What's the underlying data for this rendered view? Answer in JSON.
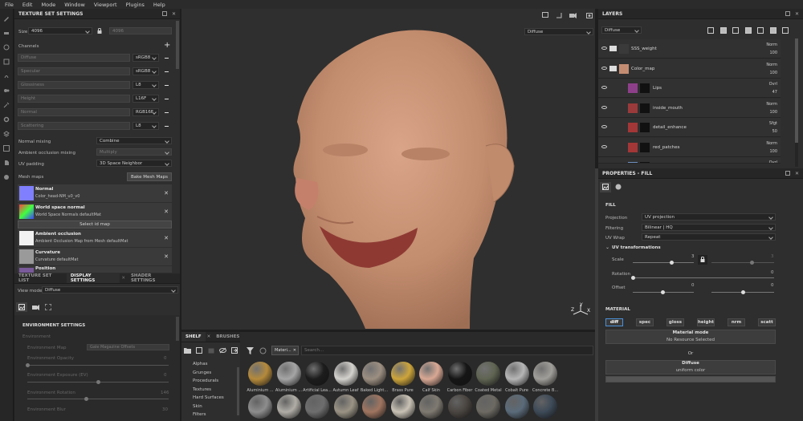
{
  "menu": [
    "File",
    "Edit",
    "Mode",
    "Window",
    "Viewport",
    "Plugins",
    "Help"
  ],
  "texture_set_settings": {
    "title": "TEXTURE SET SETTINGS",
    "size_label": "Size",
    "size_value": "4096",
    "size_linked": "4096",
    "channels_label": "Channels",
    "channels": [
      {
        "name": "Diffuse",
        "format": "sRGB8"
      },
      {
        "name": "Specular",
        "format": "sRGB8"
      },
      {
        "name": "Glossiness",
        "format": "L8"
      },
      {
        "name": "Height",
        "format": "L16F"
      },
      {
        "name": "Normal",
        "format": "RGB16F"
      },
      {
        "name": "Scattering",
        "format": "L8"
      }
    ],
    "normal_mixing_label": "Normal mixing",
    "normal_mixing_value": "Combine",
    "ao_mixing_label": "Ambient occlusion mixing",
    "ao_mixing_value": "Multiply",
    "uv_padding_label": "UV padding",
    "uv_padding_value": "3D Space Neighbor",
    "mesh_maps_label": "Mesh maps",
    "bake_button": "Bake Mesh Maps",
    "mesh_maps": [
      {
        "title": "Normal",
        "sub": "Color_head-NM_u0_v0"
      },
      {
        "title": "World space normal",
        "sub": "World Space Normals defaultMat"
      },
      {
        "title": "Ambient occlusion",
        "sub": "Ambient Occlusion Map from Mesh defaultMat"
      },
      {
        "title": "Curvature",
        "sub": "Curvature defaultMat"
      },
      {
        "title": "Position",
        "sub": ""
      }
    ],
    "select_id_map": "Select id map"
  },
  "lower_tabs": [
    "TEXTURE SET LIST",
    "DISPLAY SETTINGS",
    "SHADER SETTINGS"
  ],
  "display_settings": {
    "view_mode_label": "View mode",
    "view_mode_value": "Diffuse",
    "env_title": "ENVIRONMENT SETTINGS",
    "env_label": "Environment",
    "env_map_label": "Environment Map",
    "env_map_value": "Gale Magazine Offsets",
    "env_opacity_label": "Environment Opacity",
    "env_opacity_value": "0",
    "env_exposure_label": "Environment Exposure (EV)",
    "env_exposure_value": "0",
    "env_rotation_label": "Environment Rotation",
    "env_rotation_value": "146",
    "env_blur_label": "Environment Blur",
    "env_blur_value": "30"
  },
  "viewport": {
    "channel_select": "Diffuse",
    "gizmo": {
      "x": "X",
      "y": "Y",
      "z": "Z"
    }
  },
  "shelf": {
    "tabs": [
      "SHELF",
      "BRUSHES"
    ],
    "filter_chip": "Materi...",
    "search_placeholder": "Search...",
    "categories": [
      "Alphas",
      "Grunges",
      "Procedurals",
      "Textures",
      "Hard Surfaces",
      "Skin",
      "Filters"
    ],
    "materials": [
      {
        "name": "Aluminium ...",
        "color": "#b58a3b"
      },
      {
        "name": "Aluminium ...",
        "color": "#a5a5a5"
      },
      {
        "name": "Artificial Lea...",
        "color": "#1c1c1c"
      },
      {
        "name": "Autumn Leaf",
        "color": "#d4d2cd"
      },
      {
        "name": "Baked Light...",
        "color": "#9c8f81"
      },
      {
        "name": "Brass Pure",
        "color": "#cda53b"
      },
      {
        "name": "Calf Skin",
        "color": "#d9a894"
      },
      {
        "name": "Carbon Fiber",
        "color": "#151515"
      },
      {
        "name": "Coated Metal",
        "color": "#5f6452"
      },
      {
        "name": "Cobalt Pure",
        "color": "#b6b6b6"
      },
      {
        "name": "Concrete B...",
        "color": "#a09e99"
      }
    ],
    "materials_row2": [
      "#8d8d8d",
      "#b0ada6",
      "#6e6e6e",
      "#9a9385",
      "#a07560",
      "#c9c2b5",
      "#7f7a71",
      "#4a4540",
      "#6d6a63",
      "#5b6b7a",
      "#3d4a58"
    ]
  },
  "layers": {
    "title": "LAYERS",
    "channel": "Diffuse",
    "items": [
      {
        "name": "SSS_weight",
        "blend": "Norm",
        "opacity": "100",
        "thumb": "#3a3a3a",
        "folder": true
      },
      {
        "name": "Color_map",
        "blend": "Norm",
        "opacity": "100",
        "thumb": "#c48d72",
        "folder": true
      },
      {
        "name": "Lips",
        "blend": "Ovrl",
        "opacity": "47",
        "thumb": "#8e3f8a",
        "folder": false
      },
      {
        "name": "inside_mouth",
        "blend": "Norm",
        "opacity": "100",
        "thumb": "#9b3a3a",
        "folder": false
      },
      {
        "name": "detail_enhance",
        "blend": "Sfgt",
        "opacity": "50",
        "thumb": "#a33737",
        "folder": false
      },
      {
        "name": "red_patches",
        "blend": "Norm",
        "opacity": "100",
        "thumb": "#a33737",
        "folder": false
      },
      {
        "name": "",
        "blend": "Ovrl",
        "opacity": "",
        "thumb": "#6e8fc0",
        "folder": false
      }
    ]
  },
  "properties": {
    "title": "PROPERTIES - FILL",
    "fill_label": "FILL",
    "projection_label": "Projection",
    "projection_value": "UV projection",
    "filtering_label": "Filtering",
    "filtering_value": "Bilinear | HQ",
    "uvwrap_label": "UV Wrap",
    "uvwrap_value": "Repeat",
    "uv_transforms_label": "UV transformations",
    "scale_label": "Scale",
    "scale_value": "3",
    "scale_value2": "3",
    "rotation_label": "Rotation",
    "rotation_value": "0",
    "offset_label": "Offset",
    "offset_value": "0",
    "offset_value2": "0",
    "material_label": "MATERIAL",
    "material_chips": [
      "diff",
      "spec",
      "gloss",
      "height",
      "nrm",
      "scatt"
    ],
    "material_mode_title": "Material mode",
    "material_mode_sub": "No Resource Selected",
    "or_label": "Or",
    "diffuse_title": "Diffuse",
    "diffuse_sub": "uniform color"
  },
  "colors": {
    "accent": "#4a90d9",
    "skin": "#c8946f"
  }
}
